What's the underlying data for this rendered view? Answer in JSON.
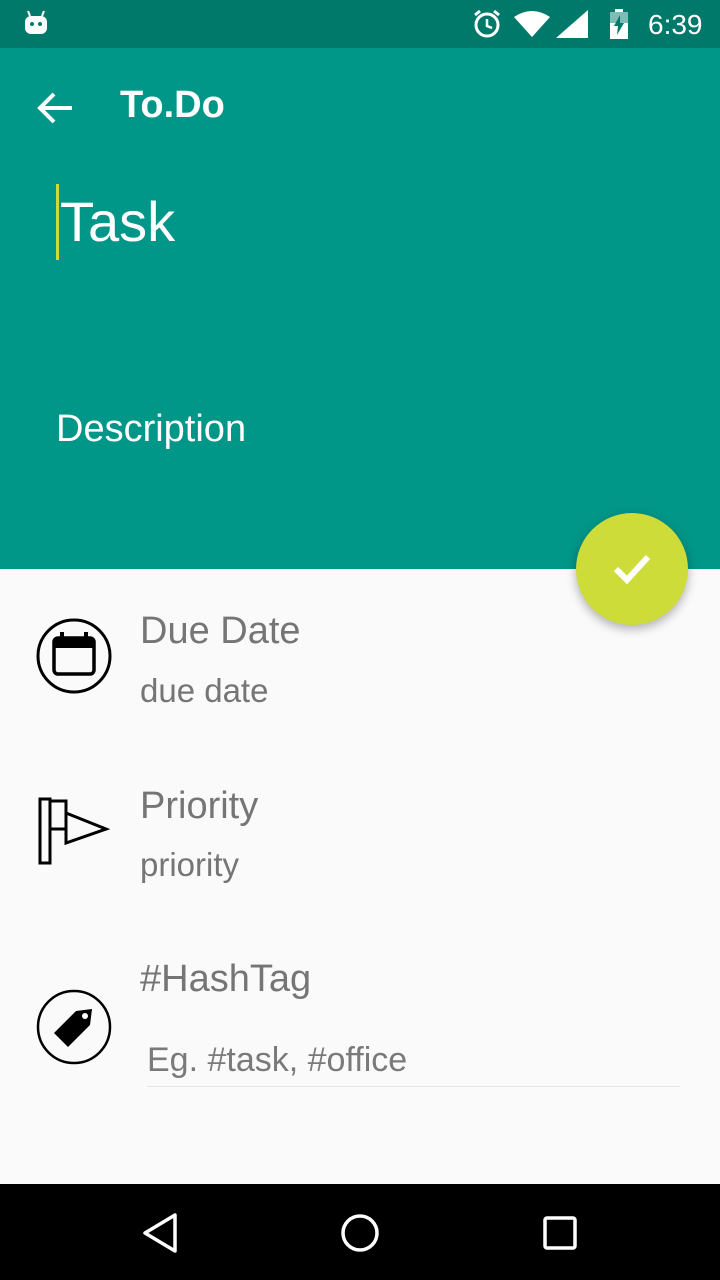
{
  "status_bar": {
    "time": "6:39",
    "icons": [
      "android-robot-icon",
      "alarm-icon",
      "wifi-icon",
      "cell-signal-icon",
      "battery-charging-icon"
    ]
  },
  "toolbar": {
    "title": "To.Do",
    "back_icon": "arrow-back-icon"
  },
  "form": {
    "task_value": "Task",
    "description_value": "Description"
  },
  "fab": {
    "icon": "check-icon",
    "color": "#cddc39"
  },
  "due_date": {
    "label": "Due Date",
    "value": "due date",
    "icon": "calendar-icon"
  },
  "priority": {
    "label": "Priority",
    "value": "priority",
    "icon": "flag-icon"
  },
  "hashtag": {
    "label": "#HashTag",
    "placeholder": "Eg. #task, #office",
    "icon": "tag-icon"
  },
  "nav_bar": {
    "icons": [
      "back-triangle-icon",
      "home-circle-icon",
      "recents-square-icon"
    ]
  },
  "colors": {
    "primary": "#009688",
    "primary_dark": "#00796b",
    "accent": "#cddc39",
    "text_secondary": "#757575"
  }
}
